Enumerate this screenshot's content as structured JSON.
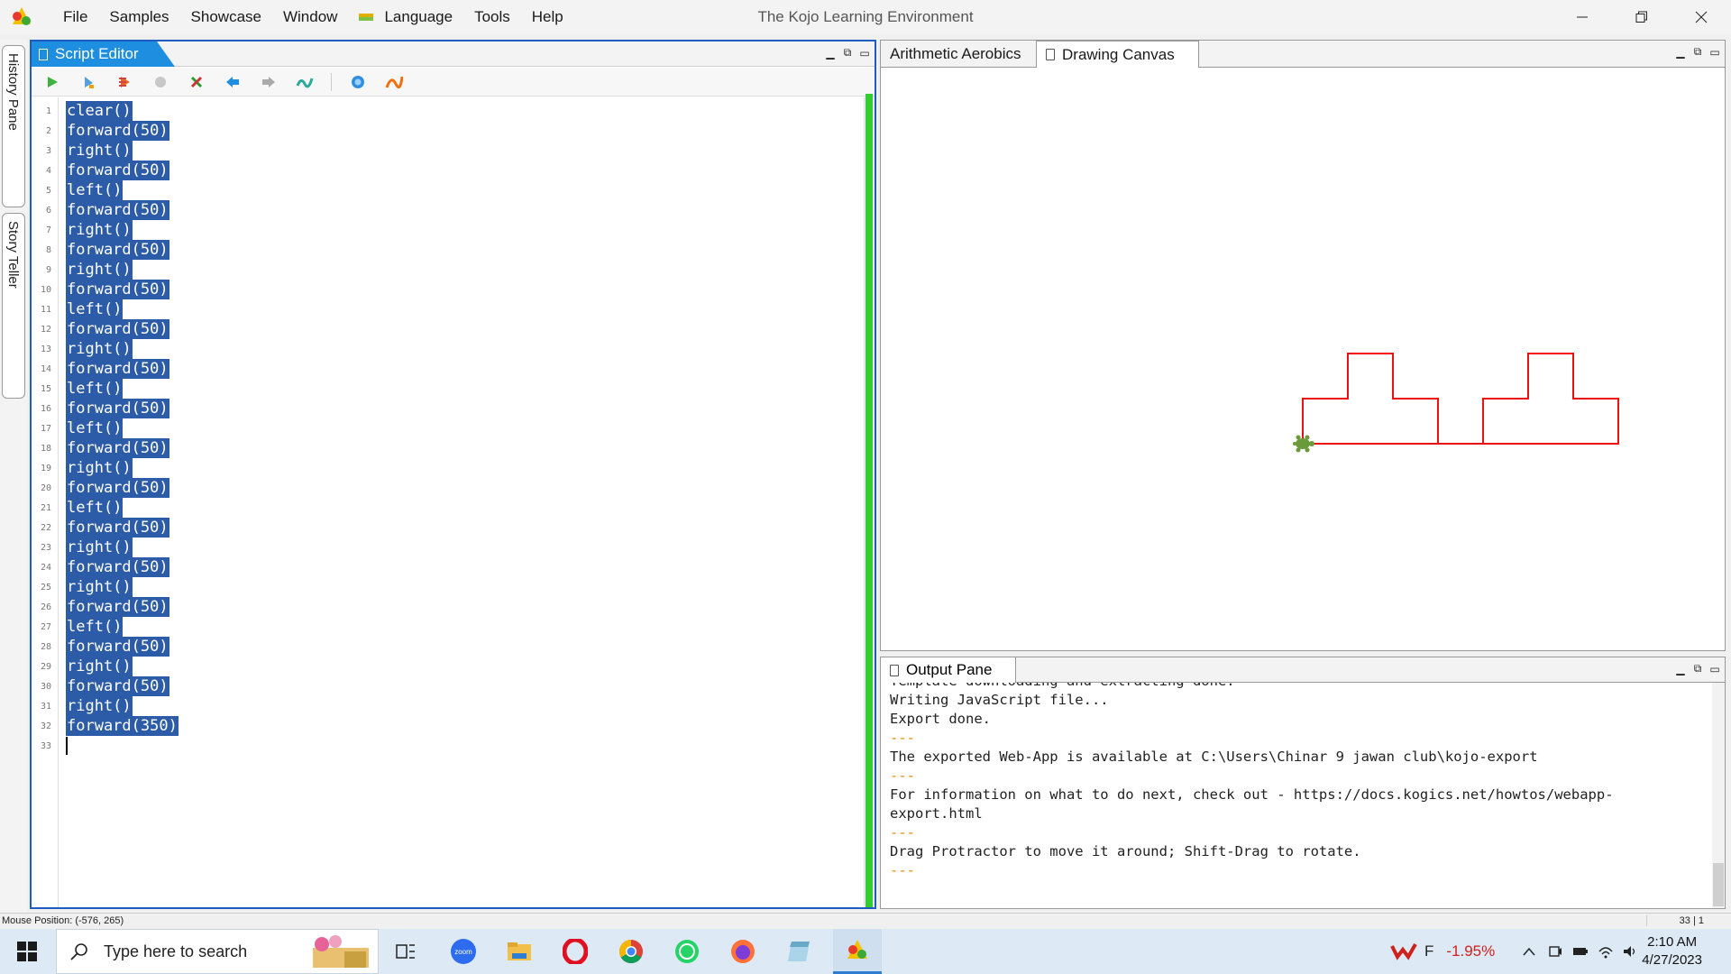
{
  "window": {
    "title": "The Kojo Learning Environment"
  },
  "menu": [
    "File",
    "Samples",
    "Showcase",
    "Window",
    "Language",
    "Tools",
    "Help"
  ],
  "sidebar": {
    "tabs": [
      "History Pane",
      "Story Teller"
    ]
  },
  "editor": {
    "tab_label": "Script Editor",
    "toolbar_icons": [
      "run-icon",
      "run-worksheet-icon",
      "trace-icon",
      "stop-icon",
      "clear-icon",
      "undo-icon",
      "redo-icon",
      "format-icon",
      "help-icon",
      "kogics-icon"
    ],
    "lines": [
      "clear()",
      "forward(50)",
      "right()",
      "forward(50)",
      "left()",
      "forward(50)",
      "right()",
      "forward(50)",
      "right()",
      "forward(50)",
      "left()",
      "forward(50)",
      "right()",
      "forward(50)",
      "left()",
      "forward(50)",
      "left()",
      "forward(50)",
      "right()",
      "forward(50)",
      "left()",
      "forward(50)",
      "right()",
      "forward(50)",
      "right()",
      "forward(50)",
      "left()",
      "forward(50)",
      "right()",
      "forward(50)",
      "right()",
      "forward(350)"
    ],
    "caret_line": 33
  },
  "canvas": {
    "tabs": [
      "Arithmetic Aerobics",
      "Drawing Canvas"
    ],
    "active_tab": "Drawing Canvas",
    "pen_color": "#ee1111"
  },
  "output": {
    "tab_label": "Output Pane",
    "lines": [
      "Template downloading and extracting done.",
      "Writing JavaScript file...",
      "Export done.",
      "---",
      "The exported Web-App is available at C:\\Users\\Chinar 9 jawan club\\kojo-export",
      "---",
      "For information on what to do next, check out - https://docs.kogics.net/howtos/webapp-",
      "export.html",
      "---",
      "Drag Protractor to move it around; Shift-Drag to rotate.",
      "---"
    ]
  },
  "status": {
    "mouse_position": "Mouse Position: (-576, 265)",
    "cursor_pos": "33 | 1"
  },
  "taskbar": {
    "search_placeholder": "Type here to search",
    "stock_label": "F",
    "stock_change": "-1.95%",
    "time": "2:10 AM",
    "date": "4/27/2023"
  }
}
